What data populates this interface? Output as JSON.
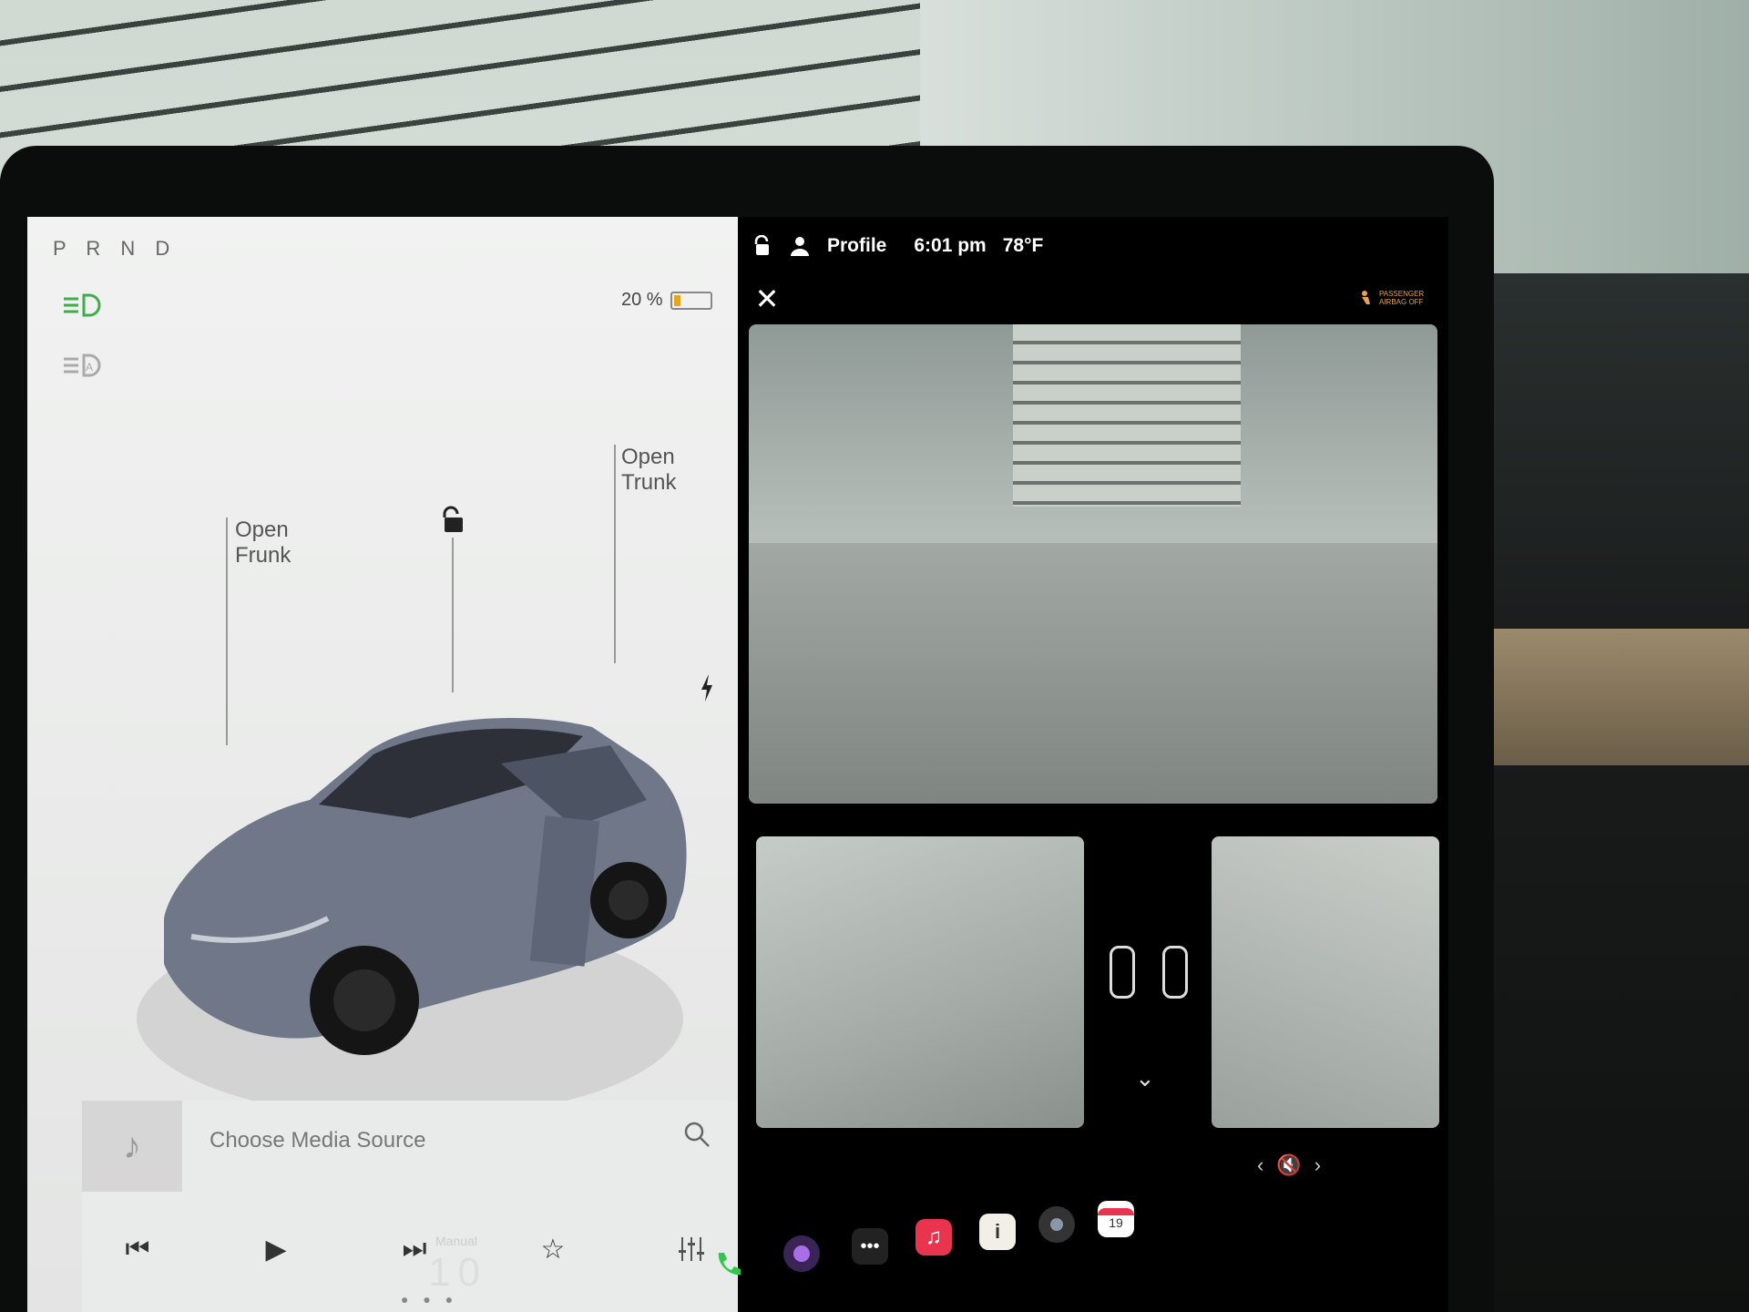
{
  "status_bar": {
    "profile_label": "Profile",
    "time": "6:01 pm",
    "temperature": "78°F",
    "airbag_line1": "PASSENGER",
    "airbag_line2": "AIRBAG OFF"
  },
  "drive": {
    "gear_selector": "P R N D",
    "battery_percent": "20 %",
    "battery_level": 0.2
  },
  "car_controls": {
    "frunk_line1": "Open",
    "frunk_line2": "Frunk",
    "trunk_line1": "Open",
    "trunk_line2": "Trunk"
  },
  "media": {
    "source_placeholder": "Choose Media Source"
  },
  "taskbar": {
    "gear_mode_label": "Manual",
    "gear_mode_value": "10",
    "apps": [
      "phone-icon",
      "camera-icon",
      "more-icon",
      "music-icon",
      "manual-icon",
      "dashcam-icon",
      "calendar-icon"
    ],
    "calendar_day": "19"
  },
  "colors": {
    "accent_green": "#3fae49",
    "battery_orange": "#e6a51c",
    "airbag_orange": "#e8a050",
    "music_red": "#e8344e",
    "phone_green": "#2fc84a"
  }
}
